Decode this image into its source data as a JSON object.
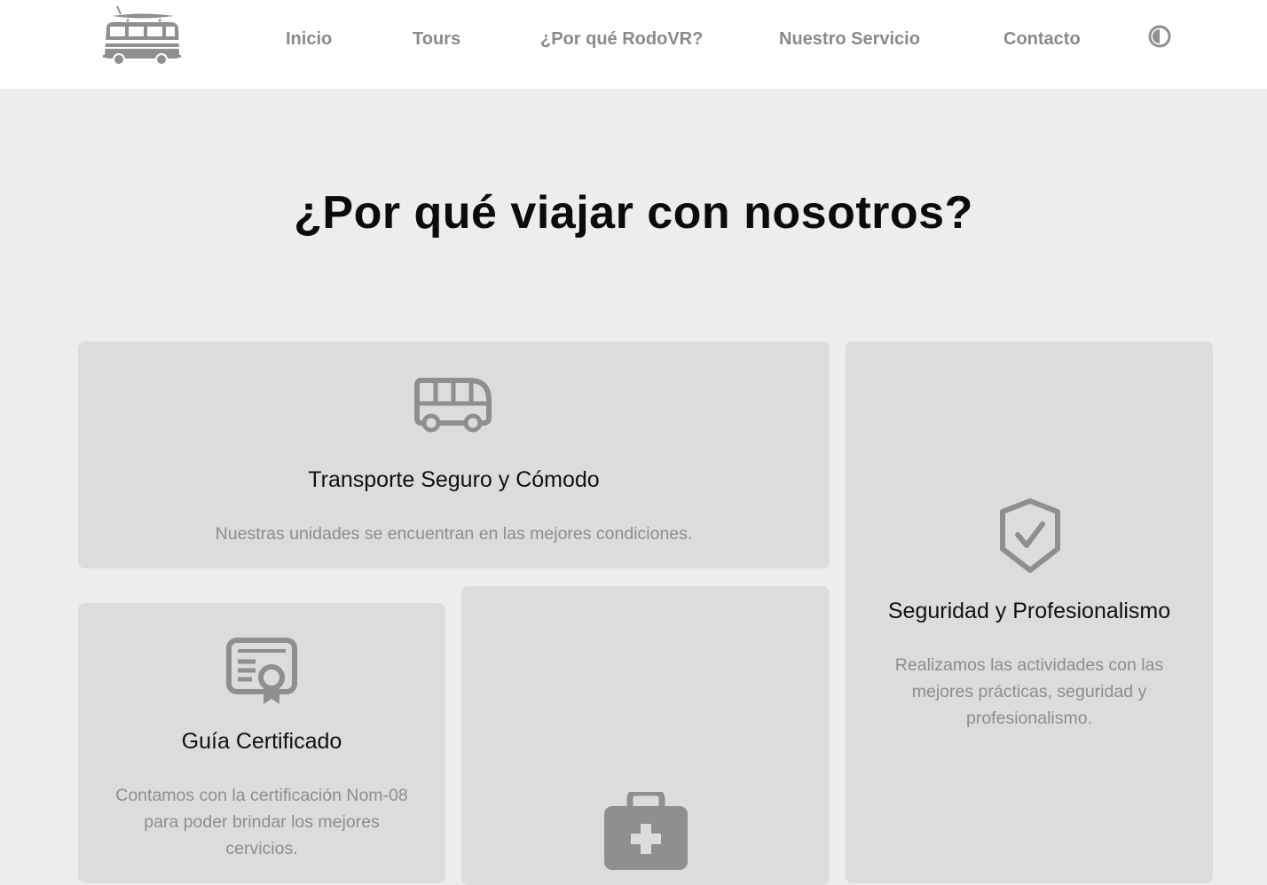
{
  "header": {
    "logo_icon": "camper-van-with-surfboard-icon",
    "nav": [
      {
        "label": "Inicio"
      },
      {
        "label": "Tours"
      },
      {
        "label": "¿Por qué RodoVR?"
      },
      {
        "label": "Nuestro Servicio"
      },
      {
        "label": "Contacto"
      }
    ],
    "theme_toggle_icon": "contrast-icon"
  },
  "main": {
    "title": "¿Por qué viajar con nosotros?",
    "cards": [
      {
        "icon": "bus-icon",
        "title": "Transporte Seguro y Cómodo",
        "text": "Nuestras unidades se encuentran en las mejores condiciones."
      },
      {
        "icon": "shield-check-icon",
        "title": "Seguridad y Profesionalismo",
        "text": "Realizamos las actividades con las mejores prácticas, seguridad y profesionalismo."
      },
      {
        "icon": "certificate-icon",
        "title": "Guía Certificado",
        "text": "Contamos con la certificación Nom-08 para poder brindar los mejores cervicios."
      },
      {
        "icon": "first-aid-kit-icon"
      }
    ]
  },
  "colors": {
    "navbar_bg": "#ffffff",
    "page_bg": "#ededed",
    "card_bg": "#dcdcdc",
    "icon_gray": "#8f8f8f",
    "nav_text": "#8a8a8a",
    "muted_text": "#8e8e8e"
  }
}
